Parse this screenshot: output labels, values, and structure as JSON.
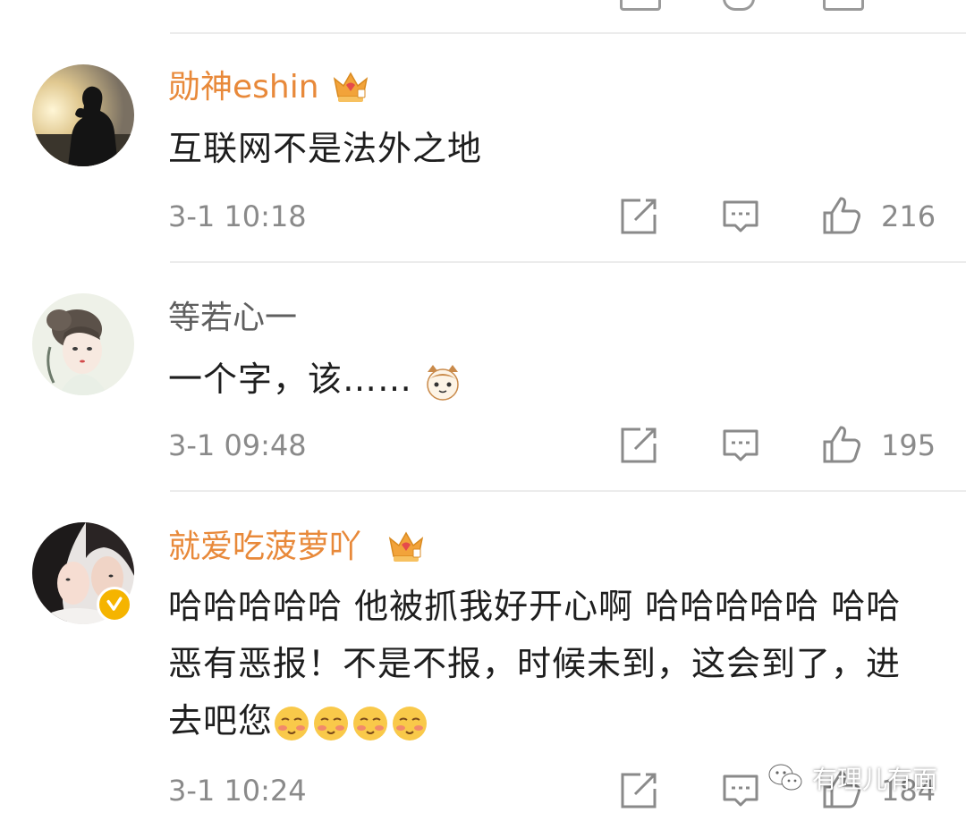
{
  "comments": [
    {
      "username": "勋神eshin",
      "vip": true,
      "text": "互联网不是法外之地",
      "time": "3-1 10:18",
      "likes": "216"
    },
    {
      "username": "等若心一",
      "vip": false,
      "text": "一个字，该……",
      "time": "3-1 09:48",
      "likes": "195"
    },
    {
      "username": "就爱吃菠萝吖",
      "vip": true,
      "verified": true,
      "text": "哈哈哈哈哈 他被抓我好开心啊 哈哈哈哈哈 哈哈 恶有恶报！不是不报，时候未到，这会到了，进去吧您",
      "time": "3-1 10:24",
      "likes": "184"
    }
  ],
  "watermark": {
    "text": "有理儿有面"
  },
  "colors": {
    "vip_name": "#e8893a",
    "meta_gray": "#8a8a8a",
    "body_text": "#1e1e1e",
    "crown": "#f2a33a",
    "verified": "#f5b400"
  },
  "icons": [
    "crown-icon",
    "share-icon",
    "comment-icon",
    "like-icon",
    "cat-emoji",
    "blush-emoji",
    "verified-badge-icon",
    "wechat-icon"
  ]
}
